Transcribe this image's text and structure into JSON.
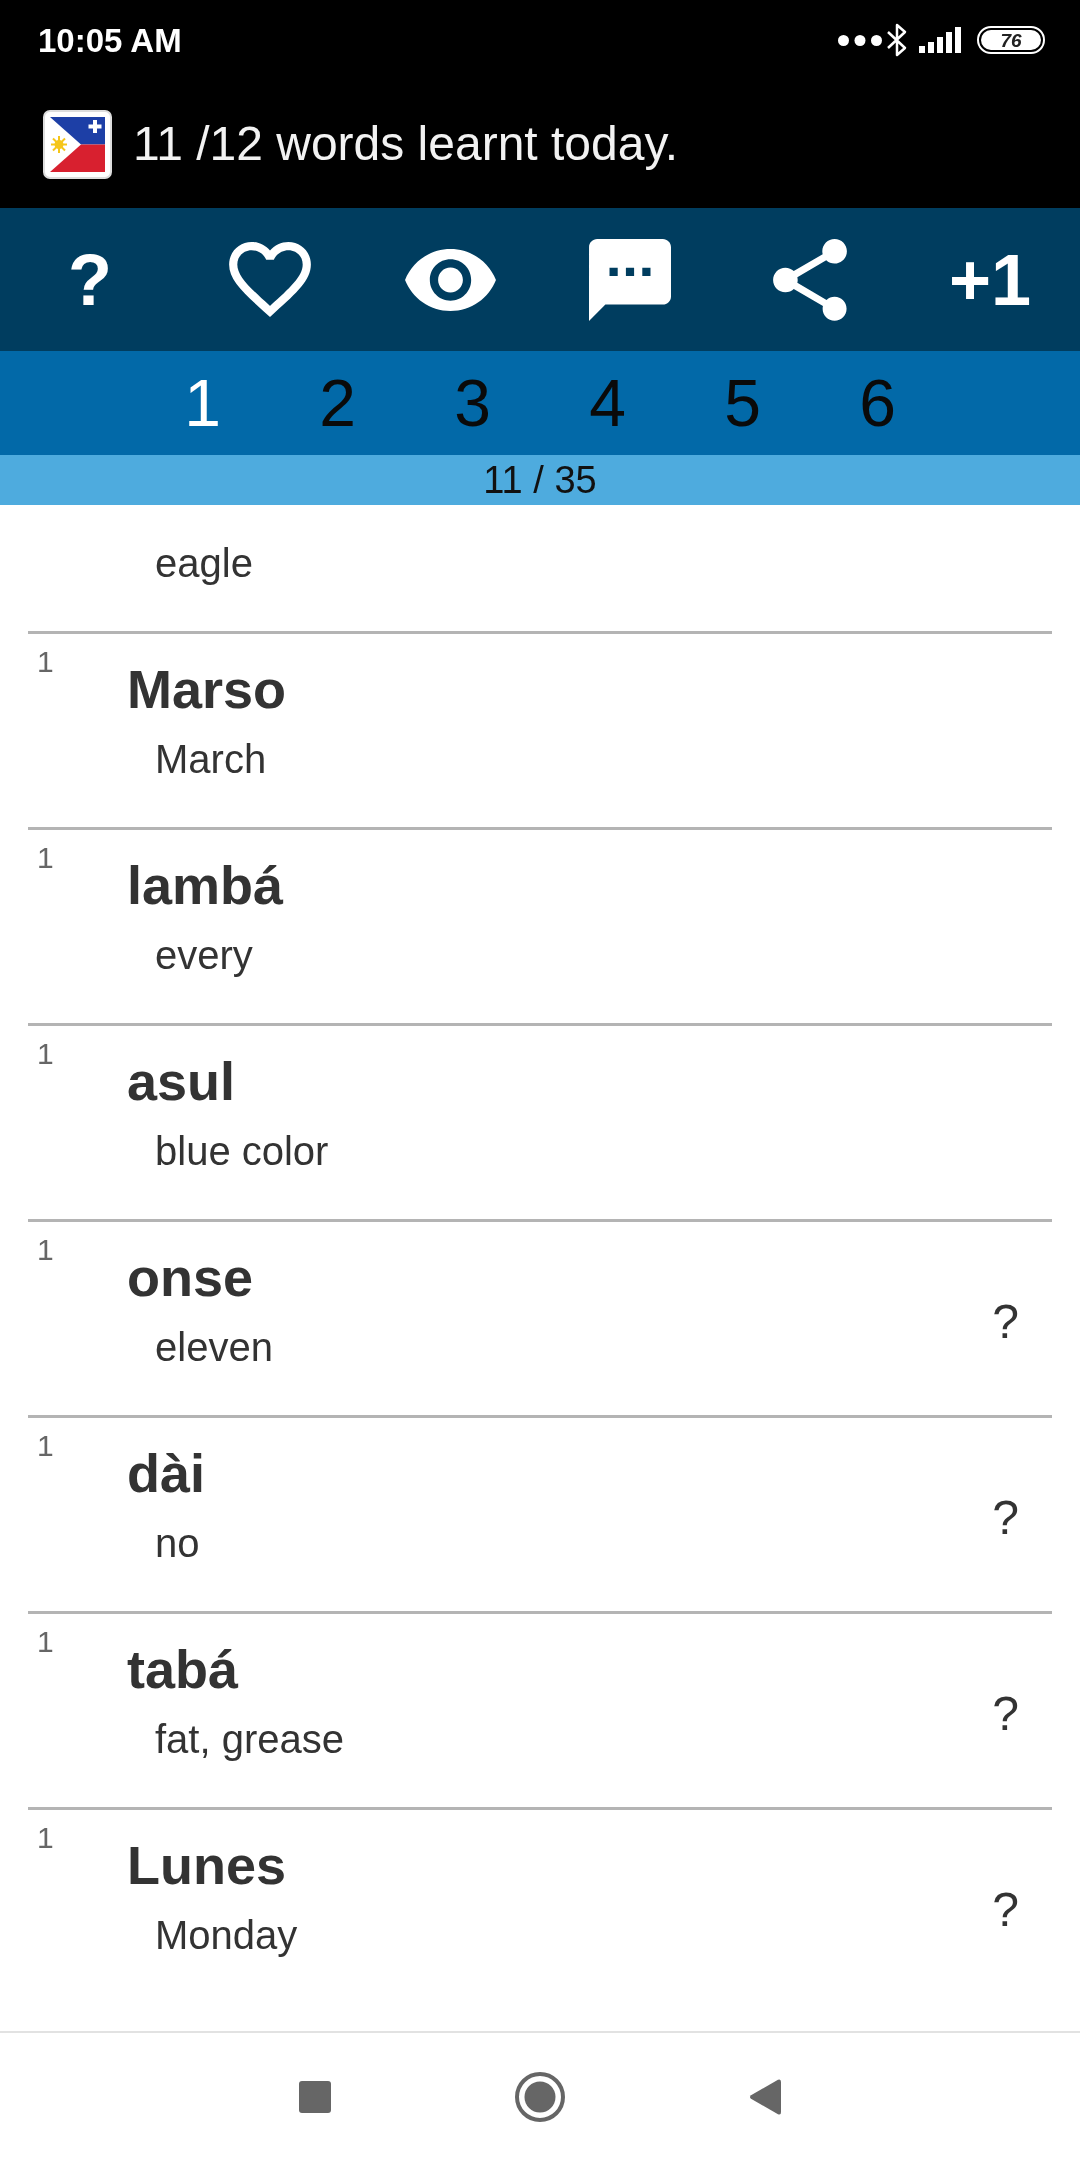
{
  "status_bar": {
    "time": "10:05 AM",
    "battery": "76"
  },
  "app_bar": {
    "title": "11 /12 words learnt today."
  },
  "toolbar": [
    {
      "kind": "help",
      "label": "?"
    },
    {
      "kind": "heart"
    },
    {
      "kind": "eye"
    },
    {
      "kind": "chat"
    },
    {
      "kind": "share"
    },
    {
      "kind": "bonus",
      "label": "+1"
    }
  ],
  "levels": [
    {
      "label": "1",
      "selected": true
    },
    {
      "label": "2",
      "selected": false
    },
    {
      "label": "3",
      "selected": false
    },
    {
      "label": "4",
      "selected": false
    },
    {
      "label": "5",
      "selected": false
    },
    {
      "label": "6",
      "selected": false
    }
  ],
  "progress": {
    "text": "11 / 35"
  },
  "words": [
    {
      "kind": "clipped",
      "translation": "eagle"
    },
    {
      "kind": "entry",
      "count": "1",
      "word": "Marso",
      "translation": "March"
    },
    {
      "kind": "entry",
      "count": "1",
      "word": "lambá",
      "translation": "every"
    },
    {
      "kind": "entry",
      "count": "1",
      "word": "asul",
      "translation": "blue color"
    },
    {
      "kind": "entry",
      "count": "1",
      "word": "onse",
      "translation": "eleven",
      "hint": "?"
    },
    {
      "kind": "entry",
      "count": "1",
      "word": "dài",
      "translation": "no",
      "hint": "?"
    },
    {
      "kind": "entry",
      "count": "1",
      "word": "tabá",
      "translation": "fat, grease",
      "hint": "?"
    },
    {
      "kind": "entry",
      "count": "1",
      "word": "Lunes",
      "translation": "Monday",
      "hint": "?"
    }
  ]
}
